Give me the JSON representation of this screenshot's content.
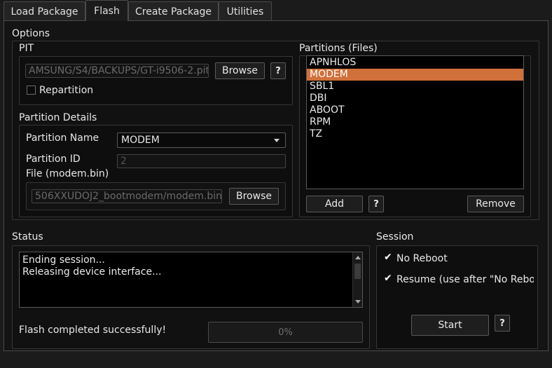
{
  "tabs": [
    {
      "label": "Load Package",
      "active": false
    },
    {
      "label": "Flash",
      "active": true
    },
    {
      "label": "Create Package",
      "active": false
    },
    {
      "label": "Utilities",
      "active": false
    }
  ],
  "options": {
    "title": "Options",
    "pit": {
      "title": "PIT",
      "path_value": "AMSUNG/S4/BACKUPS/GT-i9506-2.pit",
      "browse_label": "Browse",
      "help_label": "?",
      "repartition_label": "Repartition",
      "repartition_checked": false
    },
    "partition_details": {
      "title": "Partition Details",
      "name_label": "Partition Name",
      "name_value": "MODEM",
      "id_label": "Partition ID",
      "id_value": "2",
      "file_label": "File (modem.bin)",
      "file_value": "506XXUDOJ2_bootmodem/modem.bin",
      "browse_label": "Browse"
    },
    "partitions": {
      "title": "Partitions (Files)",
      "items": [
        "APNHLOS",
        "MODEM",
        "SBL1",
        "DBI",
        "ABOOT",
        "RPM",
        "TZ"
      ],
      "selected": "MODEM",
      "add_label": "Add",
      "help_label": "?",
      "remove_label": "Remove"
    }
  },
  "status": {
    "title": "Status",
    "log_lines": [
      "Ending session...",
      "Releasing device interface..."
    ],
    "message": "Flash completed successfully!",
    "progress_text": "0%",
    "progress_value": 0
  },
  "session": {
    "title": "Session",
    "no_reboot_label": "No Reboot",
    "no_reboot_checked": true,
    "resume_label": "Resume (use after \"No Rebo",
    "resume_checked": true,
    "start_label": "Start",
    "help_label": "?"
  },
  "colors": {
    "accent": "#d0703a",
    "background": "#1b1b1b"
  }
}
